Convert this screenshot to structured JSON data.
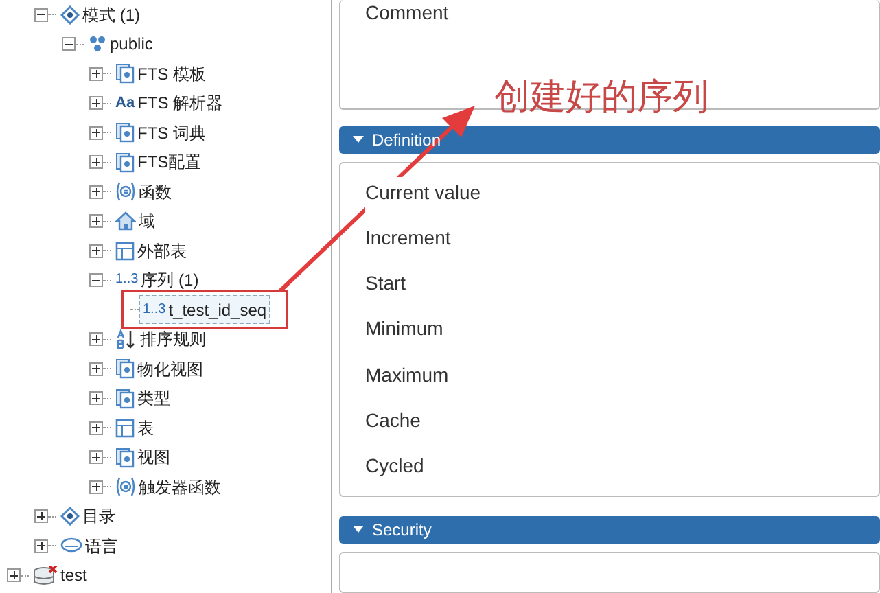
{
  "tree": [
    {
      "children": [
        {
          "label": "模式 (1)",
          "kind": "schema",
          "expanded": true,
          "selected": false,
          "children": [
            {
              "label": "public",
              "kind": "public",
              "expanded": true,
              "selected": false,
              "children": [
                {
                  "label": "FTS 模板",
                  "kind": "template",
                  "expanded": false,
                  "selected": false
                },
                {
                  "label": "FTS 解析器",
                  "kind": "parser",
                  "icon_text": "Aa",
                  "expanded": false,
                  "selected": false
                },
                {
                  "label": "FTS 词典",
                  "kind": "dictionary",
                  "expanded": false,
                  "selected": false
                },
                {
                  "label": "FTS配置",
                  "kind": "config",
                  "expanded": false,
                  "selected": false
                },
                {
                  "label": "函数",
                  "kind": "function",
                  "expanded": false,
                  "selected": false
                },
                {
                  "label": "域",
                  "kind": "domain",
                  "expanded": false,
                  "selected": false
                },
                {
                  "label": "外部表",
                  "kind": "foreign-table",
                  "expanded": false,
                  "selected": false
                },
                {
                  "label": "序列 (1)",
                  "kind": "sequence-group",
                  "icon_text": "1..3",
                  "expanded": true,
                  "selected": false,
                  "children": [
                    {
                      "label": "t_test_id_seq",
                      "kind": "sequence",
                      "icon_text": "1..3",
                      "selected": true
                    }
                  ]
                },
                {
                  "label": "排序规则",
                  "kind": "collation",
                  "expanded": false,
                  "selected": false
                },
                {
                  "label": "物化视图",
                  "kind": "matview",
                  "expanded": false,
                  "selected": false
                },
                {
                  "label": "类型",
                  "kind": "type",
                  "expanded": false,
                  "selected": false
                },
                {
                  "label": "表",
                  "kind": "table",
                  "expanded": false,
                  "selected": false
                },
                {
                  "label": "视图",
                  "kind": "view",
                  "expanded": false,
                  "selected": false
                },
                {
                  "label": "触发器函数",
                  "kind": "trigger-function",
                  "expanded": false,
                  "selected": false
                }
              ]
            }
          ]
        },
        {
          "label": "目录",
          "kind": "catalog",
          "expanded": false,
          "selected": false
        },
        {
          "label": "语言",
          "kind": "language",
          "expanded": false,
          "selected": false
        }
      ]
    },
    {
      "label": "test",
      "kind": "database",
      "expanded": false,
      "selected": false
    }
  ],
  "panel": {
    "comment_label": "Comment",
    "sections": [
      {
        "title": "Definition",
        "expanded": true,
        "fields": [
          "Current value",
          "Increment",
          "Start",
          "Minimum",
          "Maximum",
          "Cache",
          "Cycled"
        ]
      },
      {
        "title": "Security",
        "expanded": true
      }
    ]
  },
  "annotation": {
    "text": "创建好的序列"
  }
}
